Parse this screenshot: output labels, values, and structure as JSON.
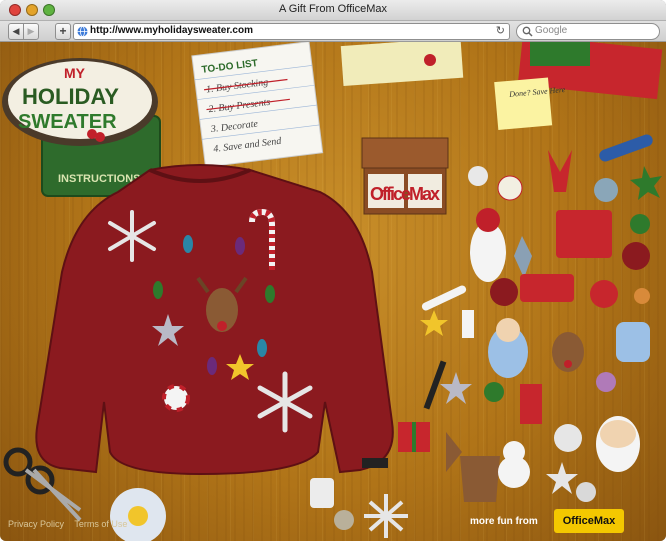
{
  "window": {
    "title": "A Gift From OfficeMax"
  },
  "toolbar": {
    "url": "http://www.myholidaysweater.com",
    "search_placeholder": "Google",
    "back": "◀",
    "forward": "▶",
    "add": "+",
    "reload": "↻"
  },
  "logo": {
    "line1": "MY",
    "line2": "HOLIDAY",
    "line3": "SWEATER",
    "instructions": "INSTRUCTIONS"
  },
  "todo": {
    "title": "TO-DO LIST",
    "items": [
      "1. Buy Stocking",
      "2. Buy Presents",
      "3. Decorate",
      "4. Save and Send"
    ],
    "struck": [
      true,
      true,
      false,
      false
    ]
  },
  "sticky": {
    "text": "Done? Save Here"
  },
  "box": {
    "letters": "OfficeMax"
  },
  "footer": {
    "privacy": "Privacy Policy",
    "terms": "Terms of Use",
    "more_fun": "more fun from",
    "brand": "OfficeMax"
  },
  "colors": {
    "wood": "#b07418",
    "sweater": "#8b1a1f",
    "brand_yellow": "#f4c800"
  }
}
